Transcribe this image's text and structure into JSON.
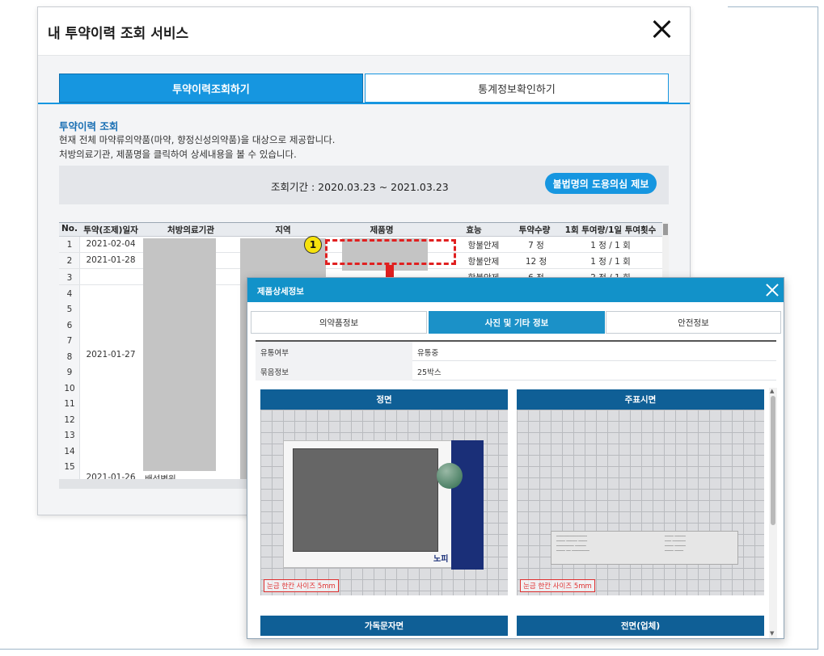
{
  "main_modal": {
    "title": "내 투약이력 조회 서비스",
    "tabs": [
      "투약이력조회하기",
      "통계정보확인하기"
    ],
    "section_title": "투약이력 조회",
    "desc_lines": [
      "현재 전체 마약류의약품(마약, 향정신성의약품)을 대상으로 제공합니다.",
      "처방의료기관, 제품명을 클릭하여 상세내용을 볼 수 있습니다."
    ],
    "period": "조회기간 : 2020.03.23 ~ 2021.03.23",
    "report_button": "불법명의 도용의심 제보",
    "table": {
      "headers": [
        "No.",
        "투약(조제)일자",
        "처방의료기관",
        "지역",
        "제품명",
        "효능",
        "투약수량",
        "1회 투여량/1일 투여횟수"
      ],
      "row_numbers": [
        "1",
        "2",
        "3",
        "4",
        "5",
        "6",
        "7",
        "8",
        "9",
        "10",
        "11",
        "12",
        "13",
        "14",
        "15"
      ],
      "rows": [
        {
          "date": "2021-02-04",
          "effect": "항불안제",
          "qty": "7 정",
          "dose": "1 정 / 1 회"
        },
        {
          "date": "2021-01-28",
          "effect": "항불안제",
          "qty": "12 정",
          "dose": "1 정 / 1 회"
        },
        {
          "date": "",
          "effect": "항불안제",
          "qty": "6 정",
          "dose": "2 정 / 1 회"
        }
      ],
      "merged_date": "2021-01-27",
      "last_date": "2021-01-26",
      "last_hospital": "배성병원"
    }
  },
  "annotation": {
    "badge": "1"
  },
  "detail_modal": {
    "title": "제품상세정보",
    "tabs": [
      "의약품정보",
      "사진 및 기타 정보",
      "안전정보"
    ],
    "info": [
      {
        "label": "유통여부",
        "value": "유통중"
      },
      {
        "label": "묶음정보",
        "value": "25박스"
      }
    ],
    "images": [
      {
        "caption": "정면",
        "scale": "눈금 한칸 사이즈 5mm"
      },
      {
        "caption": "주표시면",
        "scale": "눈금 한칸 사이즈 5mm"
      }
    ],
    "logo_text": "노피",
    "more_captions": [
      "가독문자면",
      "전면(업체)"
    ]
  }
}
